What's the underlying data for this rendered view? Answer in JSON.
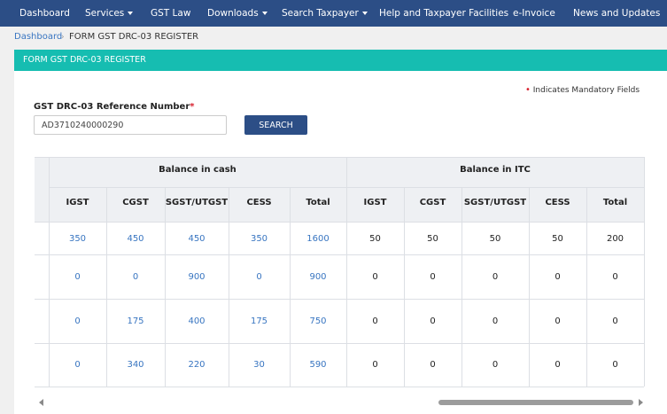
{
  "nav": {
    "items": [
      {
        "label": "Dashboard",
        "dropdown": false
      },
      {
        "label": "Services",
        "dropdown": true
      },
      {
        "label": "GST Law",
        "dropdown": false
      },
      {
        "label": "Downloads",
        "dropdown": true
      },
      {
        "label": "Search Taxpayer",
        "dropdown": true
      },
      {
        "label": "Help and Taxpayer Facilities",
        "dropdown": false
      },
      {
        "label": "e-Invoice",
        "dropdown": false
      },
      {
        "label": "News and Updates",
        "dropdown": false
      }
    ]
  },
  "breadcrumb": {
    "home": "Dashboard",
    "separator": "›",
    "current": "FORM GST DRC-03 REGISTER"
  },
  "panel": {
    "title": "FORM GST DRC-03 REGISTER"
  },
  "form": {
    "mandatory_marker": "•",
    "mandatory_note": "Indicates Mandatory Fields",
    "ref_label": "GST DRC-03 Reference Number",
    "required_star": "*",
    "ref_value": "AD3710240000290",
    "search_label": "SEARCH"
  },
  "table": {
    "groups": [
      "Balance in cash",
      "Balance in ITC"
    ],
    "columns": [
      "IGST",
      "CGST",
      "SGST/UTGST",
      "CESS",
      "Total",
      "IGST",
      "CGST",
      "SGST/UTGST",
      "CESS",
      "Total"
    ],
    "rows": [
      [
        "350",
        "450",
        "450",
        "350",
        "1600",
        "50",
        "50",
        "50",
        "50",
        "200"
      ],
      [
        "0",
        "0",
        "900",
        "0",
        "900",
        "0",
        "0",
        "0",
        "0",
        "0"
      ],
      [
        "0",
        "175",
        "400",
        "175",
        "750",
        "0",
        "0",
        "0",
        "0",
        "0"
      ],
      [
        "0",
        "340",
        "220",
        "30",
        "590",
        "0",
        "0",
        "0",
        "0",
        "0"
      ]
    ]
  },
  "colors": {
    "nav_bg": "#2c4e86",
    "panel_header_bg": "#16bdb1",
    "link": "#3875c1",
    "required": "#d8202e"
  }
}
